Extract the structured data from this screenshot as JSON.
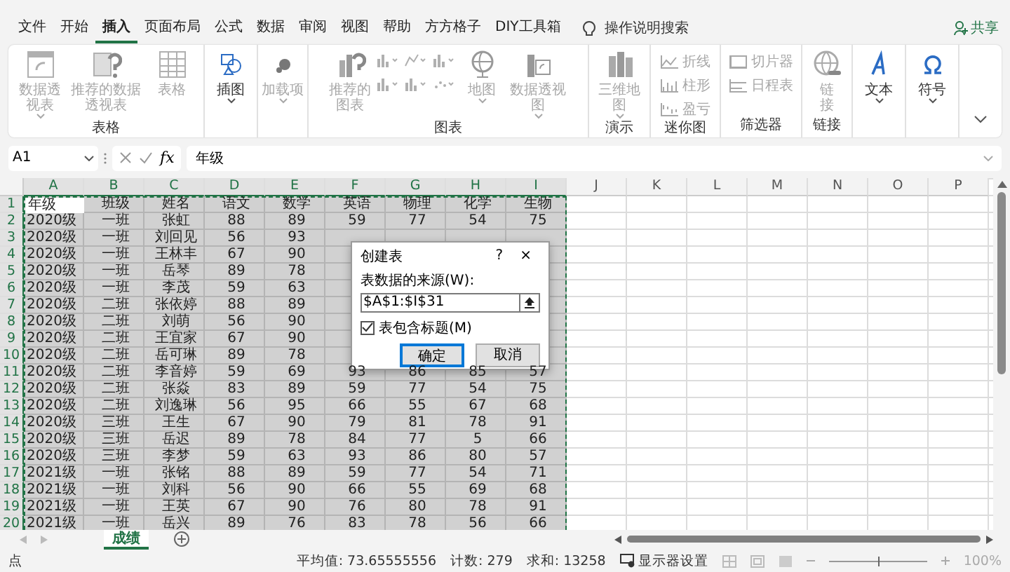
{
  "menu": {
    "tabs": [
      {
        "label": "文件",
        "selected": false
      },
      {
        "label": "开始",
        "selected": false
      },
      {
        "label": "插入",
        "selected": true
      },
      {
        "label": "页面布局",
        "selected": false
      },
      {
        "label": "公式",
        "selected": false
      },
      {
        "label": "数据",
        "selected": false
      },
      {
        "label": "审阅",
        "selected": false
      },
      {
        "label": "视图",
        "selected": false
      },
      {
        "label": "帮助",
        "selected": false
      },
      {
        "label": "方方格子",
        "selected": false
      },
      {
        "label": "DIY工具箱",
        "selected": false
      }
    ],
    "search": "操作说明搜索",
    "share": "共享"
  },
  "ribbon": {
    "groups": [
      {
        "label": "表格",
        "items": [
          {
            "kind": "large",
            "label": "数据透视表",
            "disabled": true,
            "dropdown": true
          },
          {
            "kind": "large",
            "label": "推荐的数据透视表",
            "disabled": true,
            "dropdown": false
          },
          {
            "kind": "large",
            "label": "表格",
            "disabled": true,
            "dropdown": false
          }
        ]
      },
      {
        "items": [
          {
            "kind": "large",
            "label": "插图",
            "disabled": false,
            "dropdown": true
          }
        ]
      },
      {
        "items": [
          {
            "kind": "large",
            "label": "加载项",
            "disabled": true,
            "dropdown": true
          }
        ]
      },
      {
        "label": "图表",
        "items": [
          {
            "kind": "large",
            "label": "推荐的图表",
            "disabled": true,
            "dropdown": false
          },
          {
            "kind": "chart-grid",
            "disabled": true
          },
          {
            "kind": "large",
            "label": "地图",
            "disabled": true,
            "dropdown": true
          },
          {
            "kind": "large",
            "label": "数据透视图",
            "disabled": true,
            "dropdown": true
          }
        ]
      },
      {
        "label": "演示",
        "items": [
          {
            "kind": "large",
            "label": "三维地图",
            "disabled": true,
            "dropdown": true
          }
        ]
      },
      {
        "label": "迷你图",
        "items": [
          {
            "kind": "small",
            "label": "折线",
            "disabled": true
          },
          {
            "kind": "small",
            "label": "柱形",
            "disabled": true
          },
          {
            "kind": "small",
            "label": "盈亏",
            "disabled": true
          }
        ]
      },
      {
        "label": "筛选器",
        "items": [
          {
            "kind": "small",
            "label": "切片器",
            "disabled": true
          },
          {
            "kind": "small",
            "label": "日程表",
            "disabled": true
          }
        ]
      },
      {
        "label": "链接",
        "items": [
          {
            "kind": "large",
            "label": "链接",
            "disabled": true,
            "dropdown": false
          }
        ]
      },
      {
        "items": [
          {
            "kind": "large",
            "label": "文本",
            "disabled": false,
            "dropdown": true
          }
        ]
      },
      {
        "items": [
          {
            "kind": "large",
            "label": "符号",
            "disabled": false,
            "dropdown": true
          }
        ]
      }
    ]
  },
  "formula_bar": {
    "name_box": "A1",
    "fx": "fx",
    "value": "年级"
  },
  "sheet": {
    "columns": [
      {
        "label": "A",
        "selected": true
      },
      {
        "label": "B",
        "selected": true
      },
      {
        "label": "C",
        "selected": true
      },
      {
        "label": "D",
        "selected": true
      },
      {
        "label": "E",
        "selected": true
      },
      {
        "label": "F",
        "selected": true
      },
      {
        "label": "G",
        "selected": true
      },
      {
        "label": "H",
        "selected": true
      },
      {
        "label": "I",
        "selected": true
      },
      {
        "label": "J",
        "selected": false
      },
      {
        "label": "K",
        "selected": false
      },
      {
        "label": "L",
        "selected": false
      },
      {
        "label": "M",
        "selected": false
      },
      {
        "label": "N",
        "selected": false
      },
      {
        "label": "O",
        "selected": false
      },
      {
        "label": "P",
        "selected": false
      }
    ],
    "rows": [
      {
        "number": "1",
        "selected": true,
        "cells": [
          "年级",
          "班级",
          "姓名",
          "语文",
          "数学",
          "英语",
          "物理",
          "化学",
          "生物"
        ]
      },
      {
        "number": "2",
        "selected": true,
        "cells": [
          "2020级",
          "一班",
          "张虹",
          "88",
          "89",
          "59",
          "77",
          "54",
          "75"
        ]
      },
      {
        "number": "3",
        "selected": true,
        "cells": [
          "2020级",
          "一班",
          "刘回见",
          "56",
          "93"
        ]
      },
      {
        "number": "4",
        "selected": true,
        "cells": [
          "2020级",
          "一班",
          "王林丰",
          "67",
          "90"
        ]
      },
      {
        "number": "5",
        "selected": true,
        "cells": [
          "2020级",
          "一班",
          "岳琴",
          "89",
          "78"
        ]
      },
      {
        "number": "6",
        "selected": true,
        "cells": [
          "2020级",
          "一班",
          "李茂",
          "59",
          "63"
        ]
      },
      {
        "number": "7",
        "selected": true,
        "cells": [
          "2020级",
          "二班",
          "张依婷",
          "88",
          "89"
        ]
      },
      {
        "number": "8",
        "selected": true,
        "cells": [
          "2020级",
          "二班",
          "刘萌",
          "56",
          "90"
        ]
      },
      {
        "number": "9",
        "selected": true,
        "cells": [
          "2020级",
          "二班",
          "王宜家",
          "67",
          "90"
        ]
      },
      {
        "number": "10",
        "selected": true,
        "cells": [
          "2020级",
          "二班",
          "岳可琳",
          "89",
          "78"
        ]
      },
      {
        "number": "11",
        "selected": true,
        "cells": [
          "2020级",
          "二班",
          "李音婷",
          "59",
          "69",
          "93",
          "86",
          "85",
          "57"
        ]
      },
      {
        "number": "12",
        "selected": true,
        "cells": [
          "2020级",
          "二班",
          "张焱",
          "83",
          "89",
          "59",
          "77",
          "54",
          "75"
        ]
      },
      {
        "number": "13",
        "selected": true,
        "cells": [
          "2020级",
          "二班",
          "刘逸琳",
          "56",
          "95",
          "66",
          "55",
          "67",
          "68"
        ]
      },
      {
        "number": "14",
        "selected": true,
        "cells": [
          "2020级",
          "三班",
          "王生",
          "67",
          "90",
          "79",
          "81",
          "78",
          "91"
        ]
      },
      {
        "number": "15",
        "selected": true,
        "cells": [
          "2020级",
          "三班",
          "岳迟",
          "89",
          "78",
          "84",
          "77",
          "5",
          "66"
        ]
      },
      {
        "number": "16",
        "selected": true,
        "cells": [
          "2020级",
          "三班",
          "李梦",
          "59",
          "63",
          "93",
          "86",
          "80",
          "57"
        ]
      },
      {
        "number": "17",
        "selected": true,
        "cells": [
          "2021级",
          "一班",
          "张铭",
          "88",
          "89",
          "59",
          "77",
          "54",
          "71"
        ]
      },
      {
        "number": "18",
        "selected": true,
        "cells": [
          "2021级",
          "一班",
          "刘科",
          "56",
          "90",
          "66",
          "55",
          "69",
          "68"
        ]
      },
      {
        "number": "19",
        "selected": true,
        "cells": [
          "2021级",
          "一班",
          "王英",
          "67",
          "90",
          "76",
          "80",
          "78",
          "91"
        ]
      },
      {
        "number": "20",
        "selected": true,
        "cells": [
          "2021级",
          "一班",
          "岳兴",
          "89",
          "76",
          "83",
          "78",
          "56",
          "66"
        ]
      }
    ]
  },
  "dialog": {
    "title": "创建表",
    "help": "?",
    "close": "×",
    "source_label": "表数据的来源(W):",
    "source_value": "$A$1:$I$31",
    "header_checkbox": {
      "label": "表包含标题(M)",
      "checked": true
    },
    "buttons": [
      {
        "label": "确定",
        "default": true
      },
      {
        "label": "取消",
        "default": false
      }
    ]
  },
  "sheet_tabs": [
    {
      "label": "成绩",
      "selected": true
    }
  ],
  "status_bar": {
    "mode": "点",
    "stats": [
      "平均值: 73.65555556",
      "计数: 279",
      "求和: 13258"
    ],
    "display_settings": "显示器设置",
    "zoom": {
      "level": 0.5,
      "reading": "100%"
    }
  }
}
